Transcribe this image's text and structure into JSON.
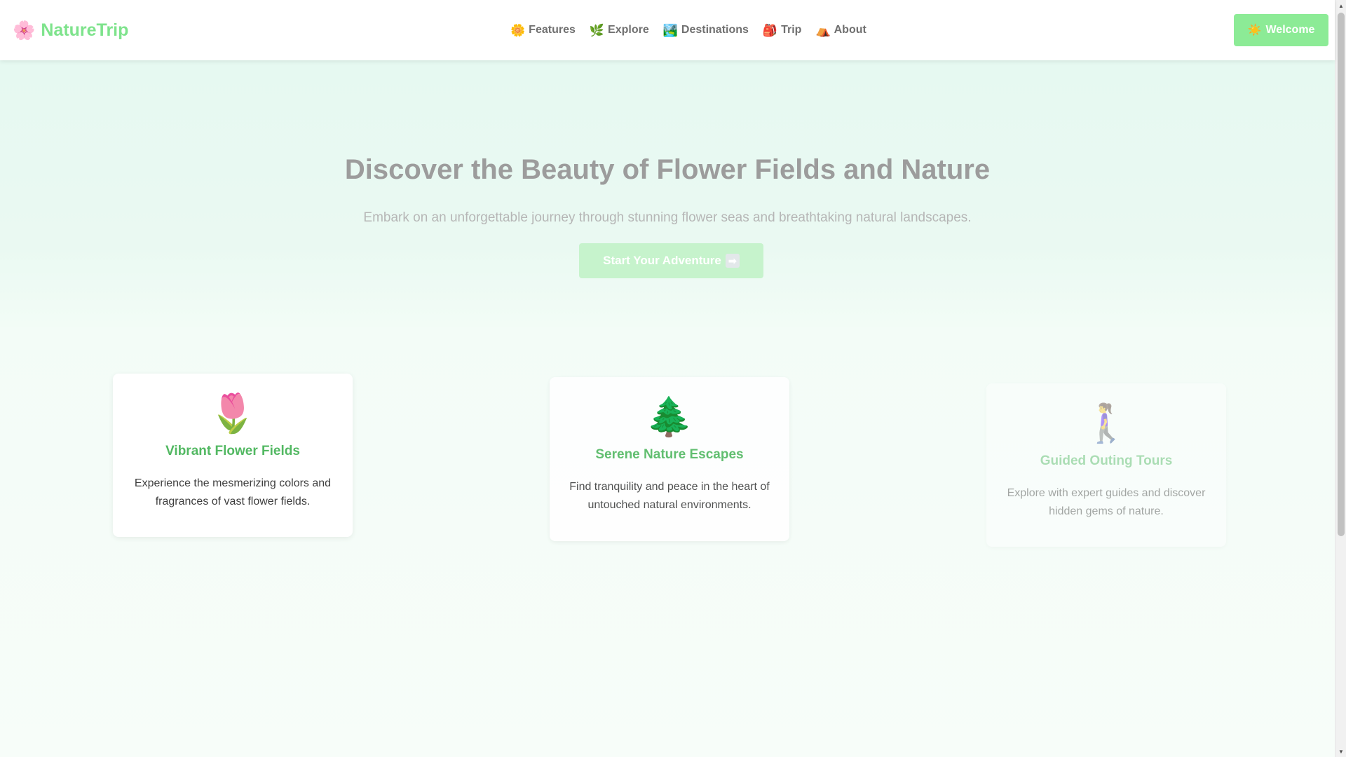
{
  "header": {
    "logo": {
      "icon": "🌸",
      "icon_name": "cherry-blossom-icon",
      "text": "NatureTrip"
    },
    "nav": [
      {
        "icon": "🌼",
        "icon_name": "blossom-icon",
        "label": "Features"
      },
      {
        "icon": "🌿",
        "icon_name": "herb-icon",
        "label": "Explore"
      },
      {
        "icon": "🏞️",
        "icon_name": "national-park-icon",
        "label": "Destinations"
      },
      {
        "icon": "🎒",
        "icon_name": "backpack-icon",
        "label": "Trip"
      },
      {
        "icon": "⛺",
        "icon_name": "tent-icon",
        "label": "About"
      }
    ],
    "welcome_button": {
      "icon": "☀️",
      "icon_name": "sun-icon",
      "label": "Welcome"
    }
  },
  "hero": {
    "title": "Discover the Beauty of Flower Fields and Nature",
    "subtitle": "Embark on an unforgettable journey through stunning flower seas and breathtaking natural landscapes.",
    "cta": {
      "label": "Start Your Adventure",
      "icon": "➡",
      "icon_name": "right-arrow-icon"
    }
  },
  "features": [
    {
      "icon": "🌷",
      "icon_name": "tulip-icon",
      "title": "Vibrant Flower Fields",
      "text": "Experience the mesmerizing colors and fragrances of vast flower fields."
    },
    {
      "icon": "🌲",
      "icon_name": "evergreen-tree-icon",
      "title": "Serene Nature Escapes",
      "text": "Find tranquility and peace in the heart of untouched natural environments."
    },
    {
      "icon": "🚶‍♀️",
      "icon_name": "person-walking-icon",
      "title": "Guided Outing Tours",
      "text": "Explore with expert guides and discover hidden gems of nature."
    }
  ],
  "colors": {
    "brand": "#7ee38c",
    "accent_button": "#8ceb96",
    "card_title": "#52b862",
    "hero_background": "#e6f9f1"
  }
}
